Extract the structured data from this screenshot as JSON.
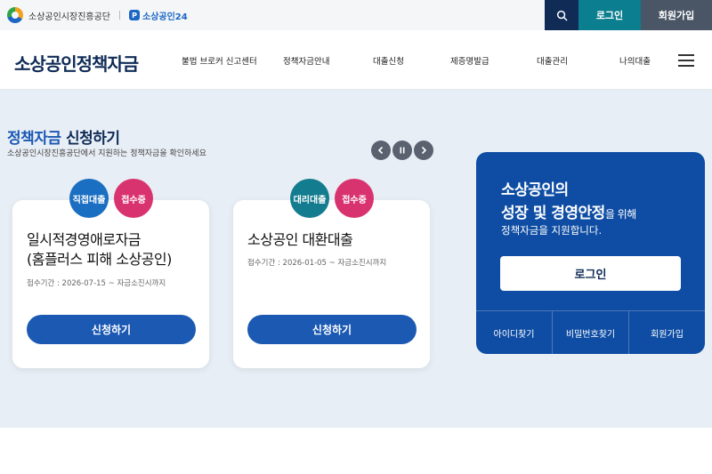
{
  "utility_bar": {
    "agency_name": "소상공인시장진흥공단",
    "portal_badge": "P",
    "portal_name": "소상공인24",
    "login_label": "로그인",
    "join_label": "회원가입"
  },
  "header": {
    "brand": "소상공인정책자금",
    "nav": [
      {
        "label": "불법 브로커 신고센터"
      },
      {
        "label": "정책자금안내"
      },
      {
        "label": "대출신청"
      },
      {
        "label": "제증명발급"
      },
      {
        "label": "대출관리"
      },
      {
        "label": "나의대출"
      }
    ]
  },
  "hero": {
    "title_part1": "정책자금",
    "title_part2": "신청하기",
    "subtitle": "소상공인시장진흥공단에서 지원하는 정책자금을 확인하세요",
    "cards": [
      {
        "badge_type": "직접대출",
        "badge_status": "접수중",
        "title_line1": "일시적경영애로자금",
        "title_line2": "(홈플러스 피해 소상공인)",
        "period": "접수기간 : 2026-07-15 ~ 자금소진시까지",
        "apply_label": "신청하기"
      },
      {
        "badge_type": "대리대출",
        "badge_status": "접수중",
        "title_line1": "소상공인 대환대출",
        "period": "접수기간 : 2026-01-05 ~ 자금소진시까지",
        "apply_label": "신청하기"
      }
    ]
  },
  "login_panel": {
    "line1": "소상공인의",
    "line2_bold": "성장 및 경영안정",
    "line2_rest": "을 위해",
    "line3": "정책자금을 지원합니다.",
    "login_label": "로그인",
    "links": [
      {
        "label": "아이디찾기"
      },
      {
        "label": "비밀번호찾기"
      },
      {
        "label": "회원가입"
      }
    ]
  },
  "colors": {
    "navy": "#0f2b56",
    "primary_blue": "#1b59b3",
    "teal": "#0b7e8f",
    "pink": "#d9336f",
    "hero_bg": "#e8eef5"
  }
}
